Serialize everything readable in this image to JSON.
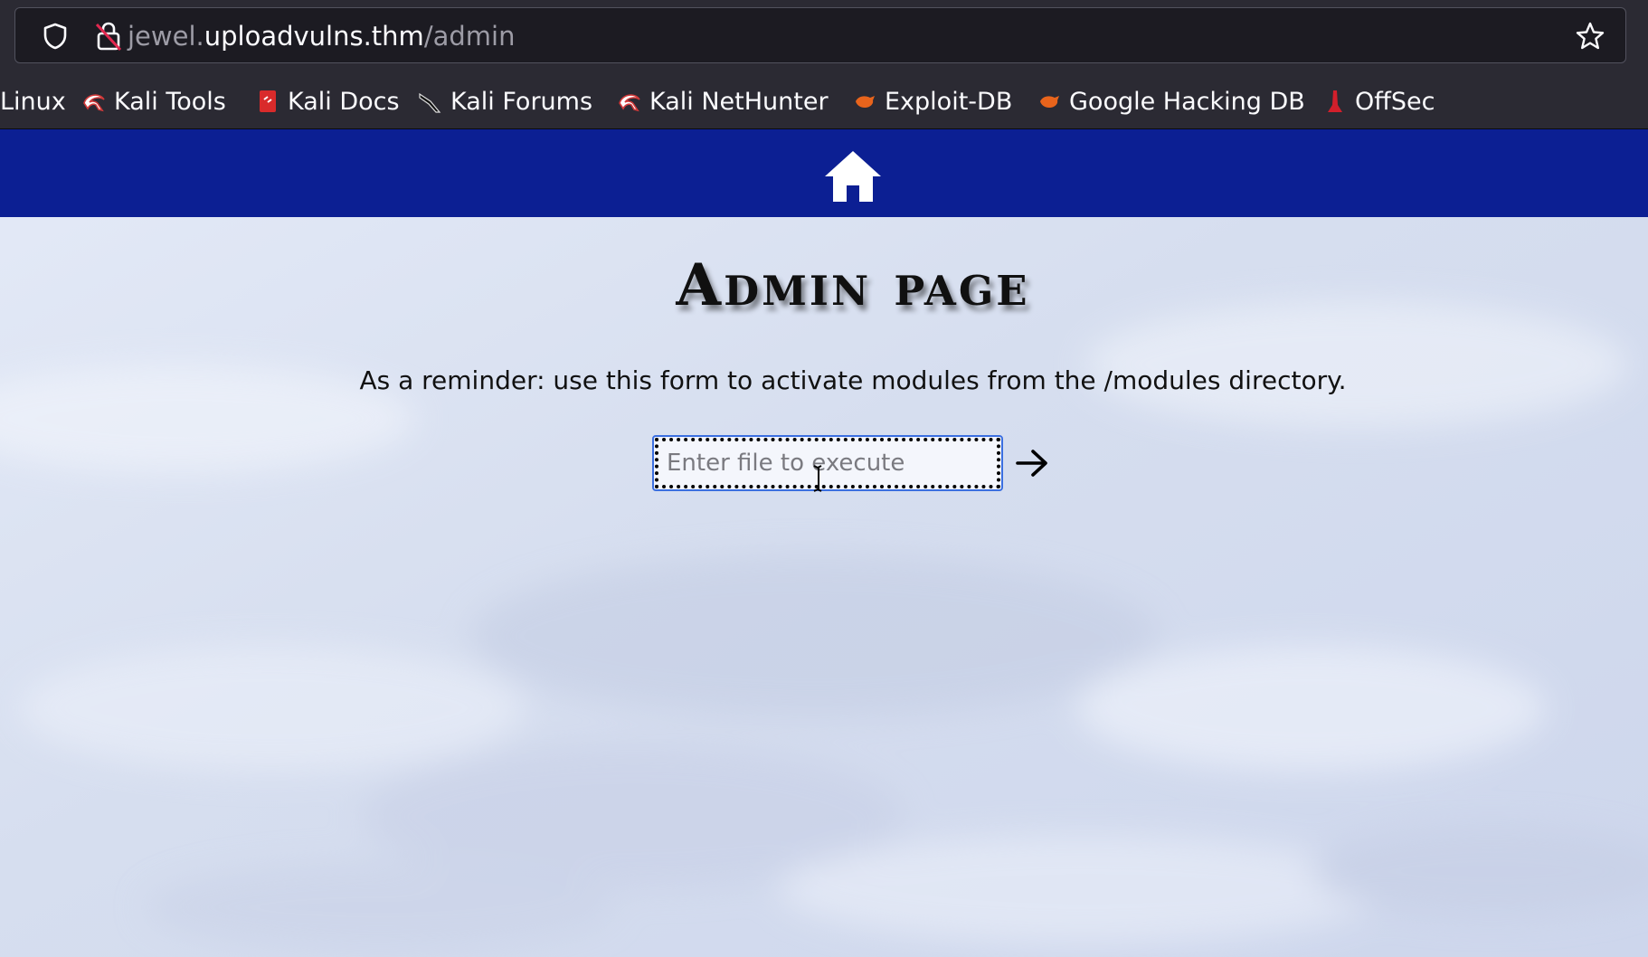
{
  "browser": {
    "url_prefix": "jewel.",
    "url_domain": "uploadvulns.thm",
    "url_path": "/admin",
    "bookmarks": [
      {
        "label": "Linux",
        "icon": "none"
      },
      {
        "label": "Kali Tools",
        "icon": "kali-dragon-icon"
      },
      {
        "label": "Kali Docs",
        "icon": "kali-docs-icon"
      },
      {
        "label": "Kali Forums",
        "icon": "kali-forums-icon"
      },
      {
        "label": "Kali NetHunter",
        "icon": "kali-dragon-icon"
      },
      {
        "label": "Exploit-DB",
        "icon": "exploit-db-icon"
      },
      {
        "label": "Google Hacking DB",
        "icon": "exploit-db-icon"
      },
      {
        "label": "OffSec",
        "icon": "offsec-icon"
      }
    ]
  },
  "page": {
    "title": "Admin page",
    "reminder": "As a reminder: use this form to activate modules from the /modules directory.",
    "input_placeholder": "Enter file to execute",
    "input_value": ""
  },
  "colors": {
    "navbar": "#0c1f93",
    "chrome_bg": "#2b2a33",
    "urlbar_bg": "#1c1b22"
  }
}
